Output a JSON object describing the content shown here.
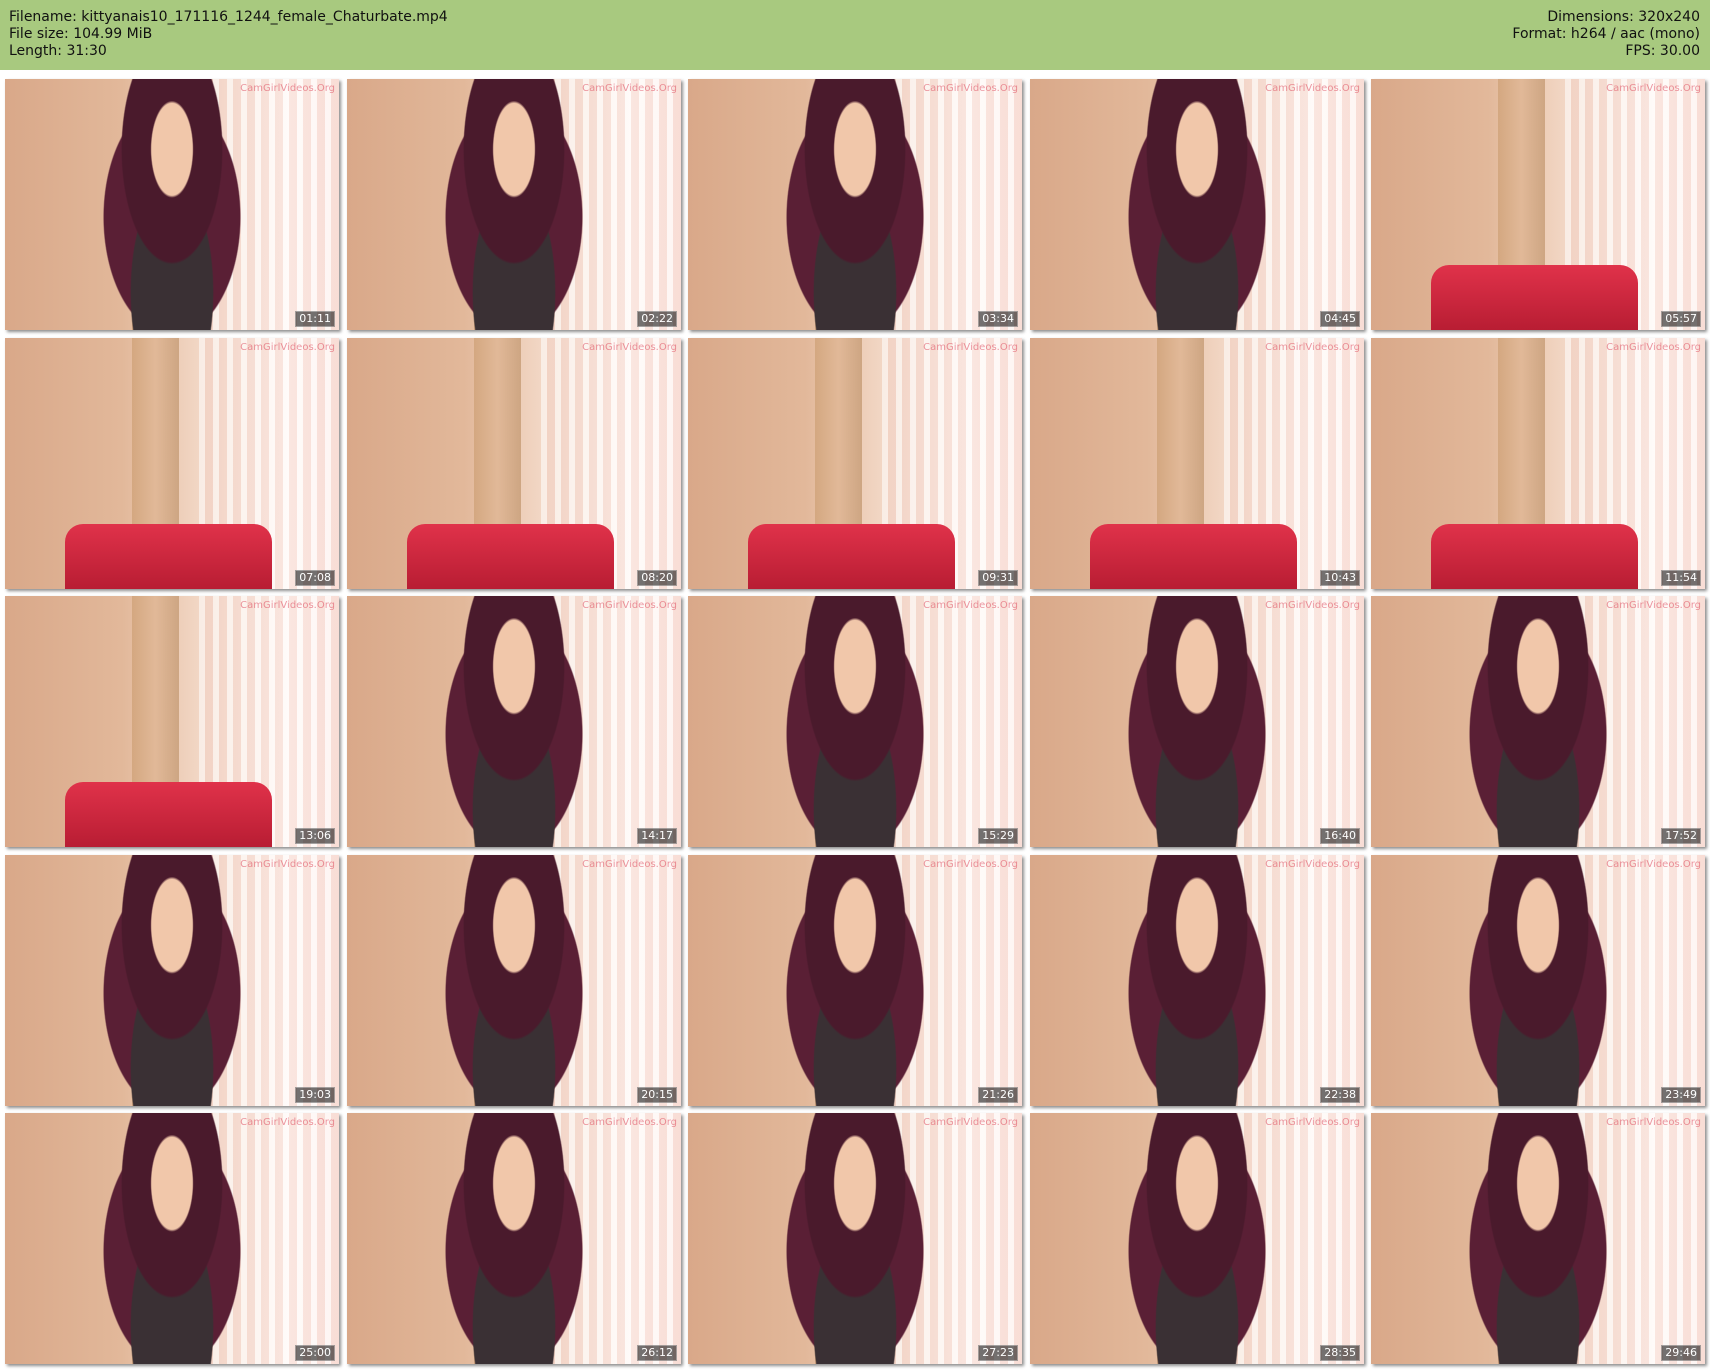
{
  "header": {
    "filename": "Filename: kittyanais10_171116_1244_female_Chaturbate.mp4",
    "filesize": "File size: 104.99 MiB",
    "length": "Length: 31:30",
    "dimensions": "Dimensions: 320x240",
    "format": "Format: h264 / aac (mono)",
    "fps": "FPS: 30.00"
  },
  "watermark": "CamGirlVideos.Org",
  "thumbnails": [
    {
      "time": "01:11",
      "scene": "person"
    },
    {
      "time": "02:22",
      "scene": "person"
    },
    {
      "time": "03:34",
      "scene": "person"
    },
    {
      "time": "04:45",
      "scene": "person"
    },
    {
      "time": "05:57",
      "scene": "empty"
    },
    {
      "time": "07:08",
      "scene": "empty"
    },
    {
      "time": "08:20",
      "scene": "empty"
    },
    {
      "time": "09:31",
      "scene": "empty"
    },
    {
      "time": "10:43",
      "scene": "empty"
    },
    {
      "time": "11:54",
      "scene": "empty"
    },
    {
      "time": "13:06",
      "scene": "empty"
    },
    {
      "time": "14:17",
      "scene": "person"
    },
    {
      "time": "15:29",
      "scene": "person"
    },
    {
      "time": "16:40",
      "scene": "person"
    },
    {
      "time": "17:52",
      "scene": "person"
    },
    {
      "time": "19:03",
      "scene": "person"
    },
    {
      "time": "20:15",
      "scene": "person"
    },
    {
      "time": "21:26",
      "scene": "person"
    },
    {
      "time": "22:38",
      "scene": "person"
    },
    {
      "time": "23:49",
      "scene": "person"
    },
    {
      "time": "25:00",
      "scene": "person"
    },
    {
      "time": "26:12",
      "scene": "person"
    },
    {
      "time": "27:23",
      "scene": "person"
    },
    {
      "time": "28:35",
      "scene": "person"
    },
    {
      "time": "29:46",
      "scene": "person"
    }
  ]
}
